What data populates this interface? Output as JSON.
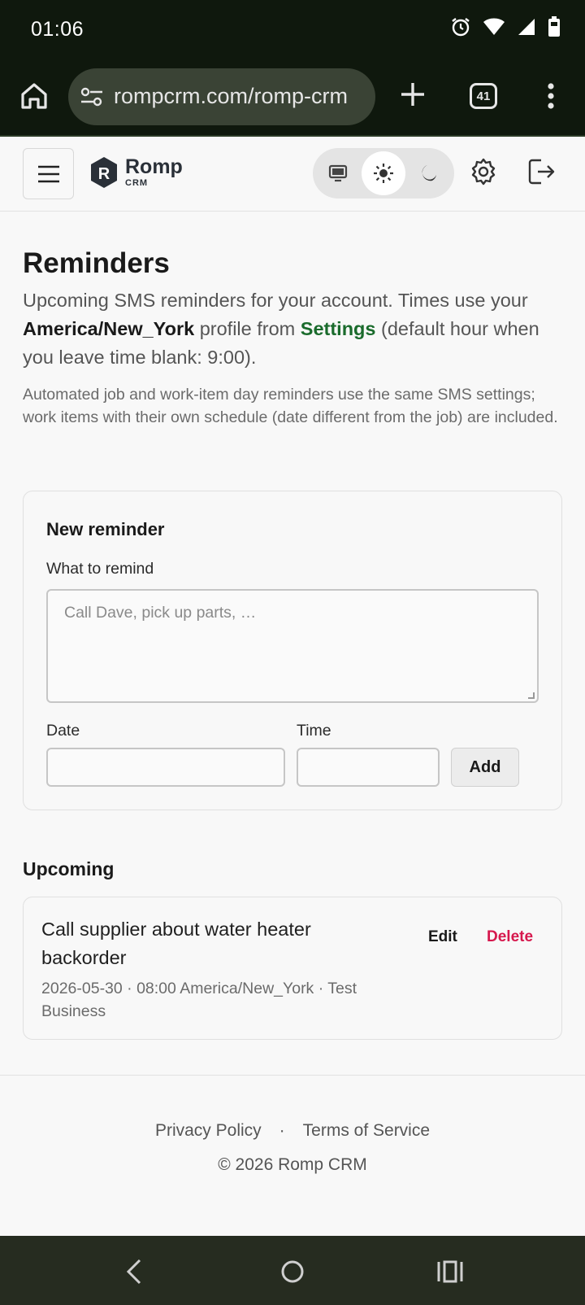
{
  "status_bar": {
    "time": "01:06"
  },
  "browser": {
    "url": "rompcrm.com/romp-crm",
    "tab_count": "41"
  },
  "app_header": {
    "brand_name": "Romp",
    "brand_sub": "CRM",
    "theme_mode": "light"
  },
  "page": {
    "title": "Reminders",
    "lead_1": "Upcoming SMS reminders for your account. Times use your ",
    "timezone": "America/New_York",
    "lead_2": " profile from ",
    "settings_link": "Settings",
    "lead_3": " (default hour when you leave time blank: 9:00).",
    "note": "Automated job and work-item day reminders use the same SMS settings; work items with their own schedule (date different from the job) are included."
  },
  "new_reminder": {
    "heading": "New reminder",
    "what_label": "What to remind",
    "what_placeholder": "Call Dave, pick up parts, …",
    "date_label": "Date",
    "time_label": "Time",
    "add_label": "Add"
  },
  "upcoming": {
    "heading": "Upcoming",
    "items": [
      {
        "title": "Call supplier about water heater backorder",
        "meta": "2026-05-30 · 08:00 America/New_York · Test Business",
        "edit_label": "Edit",
        "delete_label": "Delete"
      }
    ]
  },
  "footer": {
    "privacy": "Privacy Policy",
    "separator": "·",
    "terms": "Terms of Service",
    "copyright": "© 2026 Romp CRM"
  },
  "colors": {
    "accent_link": "#1a6b2c",
    "danger": "#d6184d",
    "system_bar": "#0f180d"
  }
}
